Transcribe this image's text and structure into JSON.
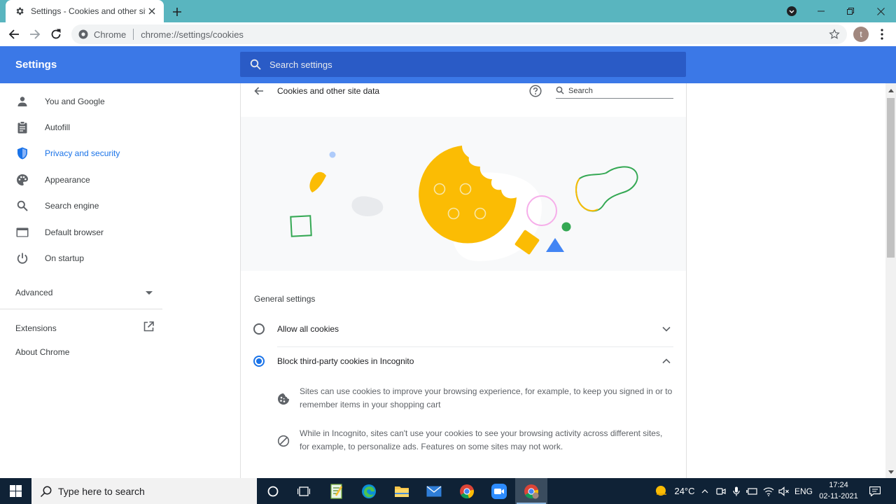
{
  "browser": {
    "tab_title": "Settings - Cookies and other site data",
    "omnibox_chip": "Chrome",
    "url": "chrome://settings/cookies",
    "profile_initial": "t"
  },
  "header": {
    "title": "Settings",
    "search_placeholder": "Search settings"
  },
  "sidebar": {
    "items": [
      {
        "label": "You and Google",
        "icon": "person-icon"
      },
      {
        "label": "Autofill",
        "icon": "clipboard-icon"
      },
      {
        "label": "Privacy and security",
        "icon": "shield-icon"
      },
      {
        "label": "Appearance",
        "icon": "palette-icon"
      },
      {
        "label": "Search engine",
        "icon": "search-icon"
      },
      {
        "label": "Default browser",
        "icon": "browser-window-icon"
      },
      {
        "label": "On startup",
        "icon": "power-icon"
      }
    ],
    "advanced_label": "Advanced",
    "extensions_label": "Extensions",
    "about_label": "About Chrome"
  },
  "main": {
    "page_title": "Cookies and other site data",
    "search_placeholder": "Search",
    "general_settings_label": "General settings",
    "options": [
      {
        "label": "Allow all cookies",
        "selected": false,
        "expanded": false
      },
      {
        "label": "Block third-party cookies in Incognito",
        "selected": true,
        "expanded": true
      }
    ],
    "details": [
      {
        "icon": "cookie-icon",
        "text": "Sites can use cookies to improve your browsing experience, for example, to keep you signed in or to remember items in your shopping cart"
      },
      {
        "icon": "block-icon",
        "text": "While in Incognito, sites can't use your cookies to see your browsing activity across different sites, for example, to personalize ads. Features on some sites may not work."
      }
    ]
  },
  "taskbar": {
    "search_placeholder": "Type here to search",
    "weather": "24°C",
    "language": "ENG",
    "time": "17:24",
    "date": "02-11-2021"
  },
  "colors": {
    "tabstrip": "#59b5bf",
    "header_blue": "#3b78e7",
    "accent": "#1a73e8",
    "cookie_yellow": "#fbbc04"
  }
}
